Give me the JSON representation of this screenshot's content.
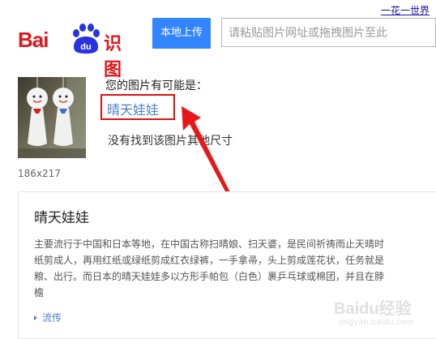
{
  "header": {
    "top_link": "一花一世界",
    "logo_prefix": "Bai",
    "logo_du": "du",
    "logo_suffix": "识图",
    "upload_label": "本地上传",
    "url_placeholder": "请粘贴图片网址或拖拽图片至此"
  },
  "result": {
    "thumbnail_size": "186x217",
    "may_be_text": "您的图片有可能是：",
    "guess": "晴天娃娃",
    "no_other_sizes": "没有找到该图片其他尺寸"
  },
  "info_card": {
    "title": "晴天娃娃",
    "lines": [
      "主要流行于中国和日本等地，在中国古称扫晴娘、扫天婆，是民间祈祷雨止天晴时",
      "纸剪成人，再用红纸或绿纸剪成红衣绿裤，一手拿帚，头上剪成莲花状，任务就是",
      "粮、出行。而日本的晴天娃娃多以方形手帕包（白色）裹乒乓球或棉团，并且在脖",
      "檐"
    ],
    "spread_link": "流传"
  },
  "watermark": {
    "main": "Baidu经验",
    "sub": "jingyan.baidu.com"
  },
  "colors": {
    "brand_red": "#e0161d",
    "brand_blue": "#2932e1",
    "button_blue": "#3385ff",
    "link_blue": "#4d7fc9",
    "highlight_red": "#e01010"
  }
}
